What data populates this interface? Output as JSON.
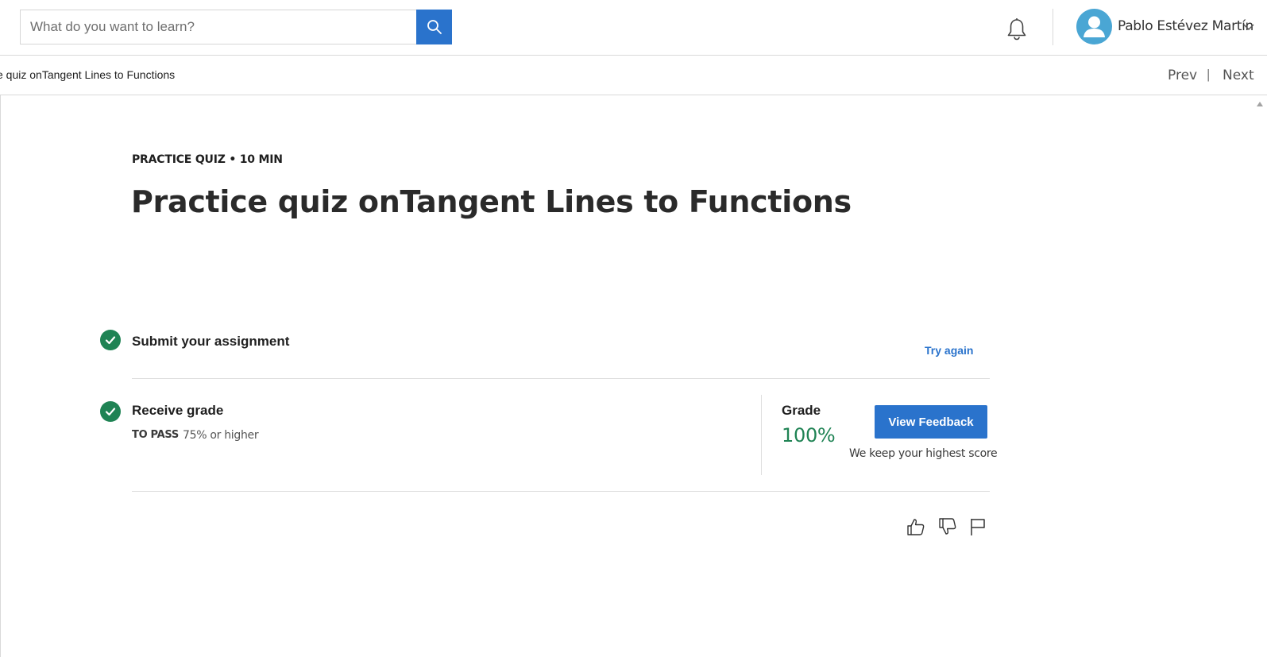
{
  "header": {
    "search": {
      "placeholder": "What do you want to learn?",
      "value": ""
    },
    "user": {
      "name": "Pablo Estévez Martín"
    }
  },
  "subbar": {
    "breadcrumb": "e quiz onTangent Lines to Functions",
    "prev_label": "Prev",
    "separator": "|",
    "next_label": "Next"
  },
  "main": {
    "kicker": "PRACTICE QUIZ • 10 MIN",
    "title": "Practice quiz onTangent Lines to Functions",
    "steps": [
      {
        "label": "Submit your assignment",
        "action_label": "Try again",
        "completed": true
      },
      {
        "label": "Receive grade",
        "to_pass_label": "TO PASS",
        "to_pass_value": "75% or higher",
        "completed": true
      }
    ],
    "grade": {
      "label": "Grade",
      "value": "100%",
      "button_label": "View Feedback",
      "note": "We keep your highest score"
    }
  },
  "icons": {
    "search": "search-icon",
    "bell": "bell-icon",
    "avatar": "user-avatar-icon",
    "chevron": "chevron-down-icon",
    "check": "check-circle-icon",
    "like": "thumbs-up-icon",
    "dislike": "thumbs-down-icon",
    "flag": "flag-icon"
  },
  "colors": {
    "primary": "#2a73cc",
    "success": "#1f8354",
    "avatar_bg": "#4aa6d4"
  }
}
